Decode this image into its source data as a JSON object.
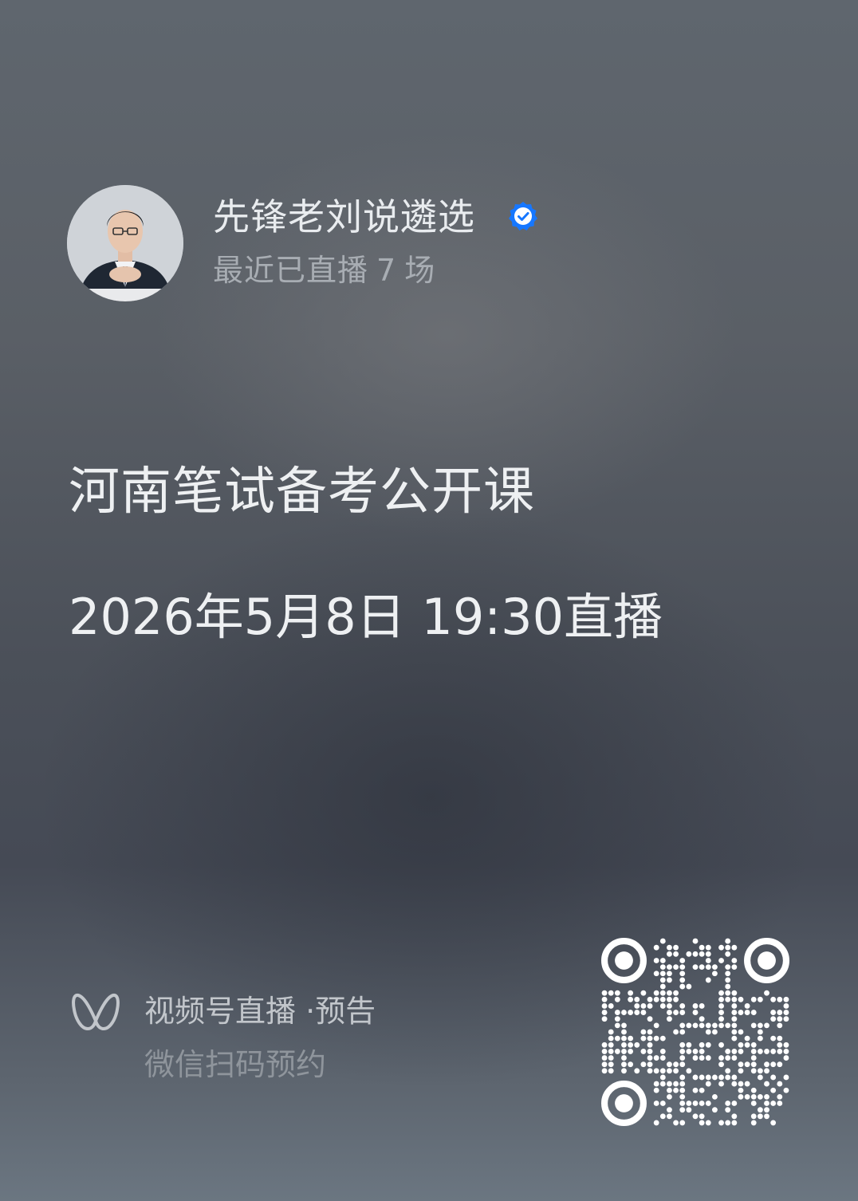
{
  "host": {
    "name": "先锋老刘说遴选",
    "stat_prefix": "最近已直播",
    "stat_count": "7",
    "stat_suffix": "场"
  },
  "event": {
    "title": "河南笔试备考公开课",
    "schedule": "2026年5月8日 19:30直播"
  },
  "footer": {
    "brand_label": "视频号直播 ·预告",
    "hint": "微信扫码预约"
  },
  "colors": {
    "verified_badge": "#1677ff",
    "text_primary": "#eef0f2",
    "text_secondary": "#a8adb3"
  },
  "icons": {
    "verified": "verified-check-icon",
    "brand": "channels-butterfly-icon",
    "qr": "qr-code"
  }
}
